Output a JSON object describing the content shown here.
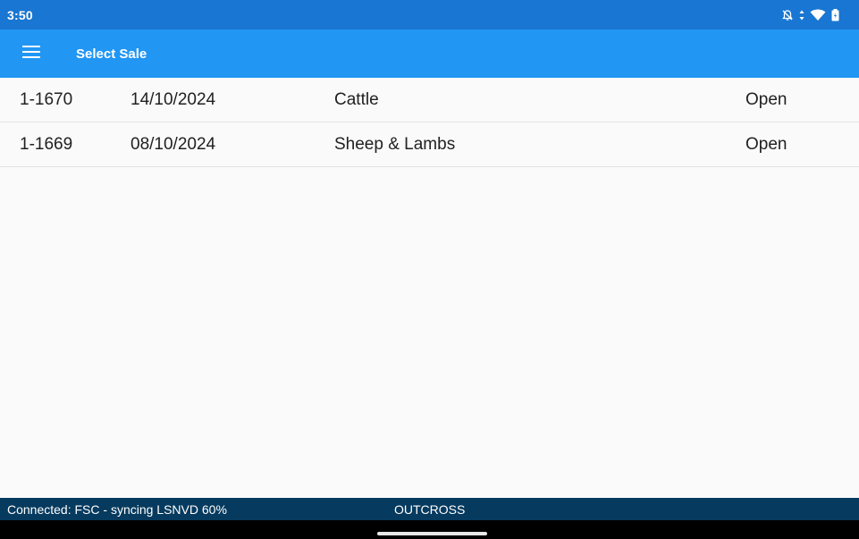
{
  "status_bar": {
    "time": "3:50",
    "icons": [
      "alarm-off-icon",
      "data-arrows-icon",
      "wifi-icon",
      "battery-icon"
    ]
  },
  "app_bar": {
    "title": "Select Sale",
    "menu_icon": "hamburger-menu-icon"
  },
  "sales": [
    {
      "id": "1-1670",
      "date": "14/10/2024",
      "type": "Cattle",
      "status": "Open"
    },
    {
      "id": "1-1669",
      "date": "08/10/2024",
      "type": "Sheep & Lambs",
      "status": "Open"
    }
  ],
  "footer": {
    "connection": "Connected: FSC - syncing LSNVD 60%",
    "brand": "OUTCROSS"
  },
  "colors": {
    "status_bar": "#1976d2",
    "app_bar": "#2196f3",
    "footer": "#063a5e",
    "background": "#fafafa"
  }
}
